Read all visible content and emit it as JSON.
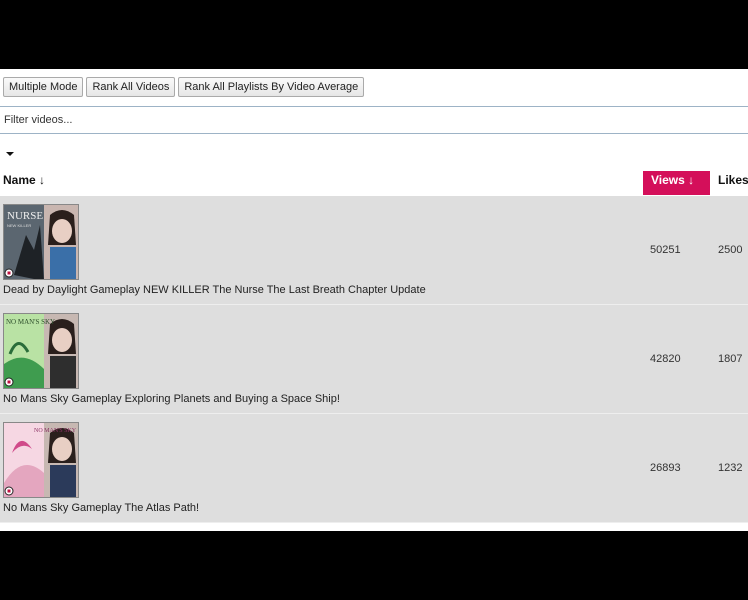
{
  "toolbar": {
    "multiple_mode": "Multiple Mode",
    "rank_all_videos": "Rank All Videos",
    "rank_all_playlists": "Rank All Playlists By Video Average"
  },
  "filter": {
    "placeholder": "Filter videos..."
  },
  "columns": {
    "name": "Name ↓",
    "views": "Views ↓",
    "likes": "Likes ↓"
  },
  "videos": [
    {
      "title": "Dead by Daylight Gameplay NEW KILLER The Nurse The Last Breath Chapter Update",
      "views": "50251",
      "likes": "2500",
      "thumb_text": "NURSE",
      "thumb_sub": "NEW KILLER"
    },
    {
      "title": "No Mans Sky Gameplay Exploring Planets and Buying a Space Ship!",
      "views": "42820",
      "likes": "1807",
      "thumb_text": "NO MAN'S SKY"
    },
    {
      "title": "No Mans Sky Gameplay The Atlas Path!",
      "views": "26893",
      "likes": "1232",
      "thumb_text": "NO MAN'S SKY"
    }
  ],
  "colors": {
    "accent": "#d40f5a",
    "row_bg": "#dedede"
  }
}
